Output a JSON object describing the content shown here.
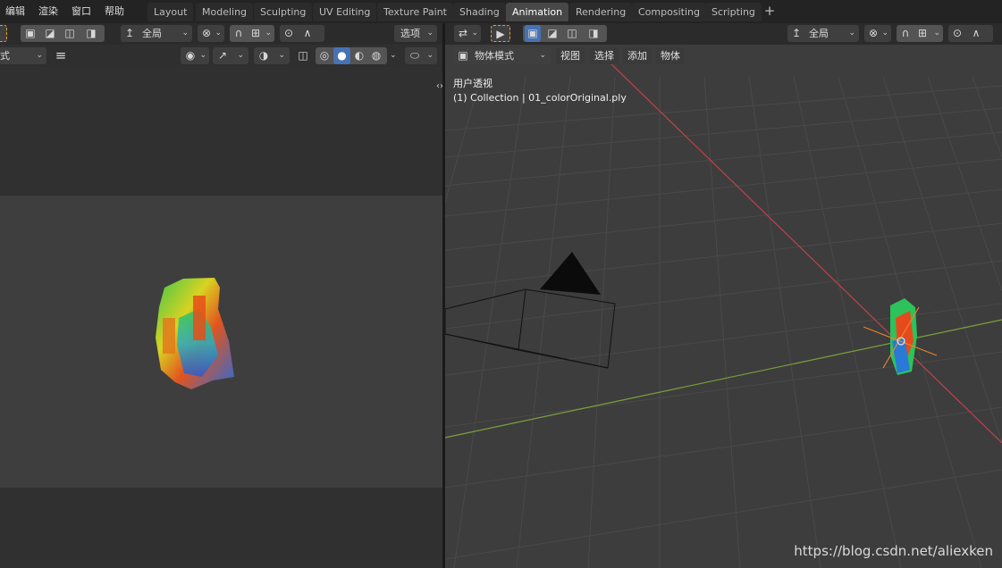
{
  "menu": [
    "编辑",
    "渲染",
    "窗口",
    "帮助"
  ],
  "workspaces": {
    "tabs": [
      "Layout",
      "Modeling",
      "Sculpting",
      "UV Editing",
      "Texture Paint",
      "Shading",
      "Animation",
      "Rendering",
      "Compositing",
      "Scripting"
    ],
    "active": "Animation",
    "add": "+"
  },
  "left_editor": {
    "orientation_label": "全局",
    "options_label": "选项",
    "mode_label": "式",
    "menu_icon": "hamburger-icon"
  },
  "right_editor": {
    "orientation_label": "全局",
    "mode_label": "物体模式",
    "menus": [
      "视图",
      "选择",
      "添加",
      "物体"
    ],
    "view_name": "用户透视",
    "collection_info": "(1) Collection | 01_colorOriginal.ply"
  },
  "colors": {
    "active_tab": "#474747",
    "x_axis": "#c4414b",
    "y_axis": "#7ba23c",
    "selected_blue": "#4772b3",
    "origin_orange": "#e5842f"
  },
  "watermark": "https://blog.csdn.net/aliexken"
}
